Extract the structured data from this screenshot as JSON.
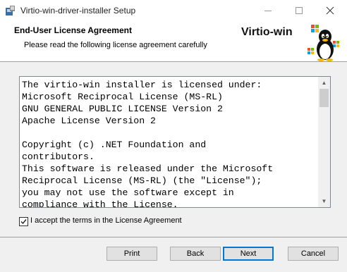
{
  "window": {
    "title": "Virtio-win-driver-installer Setup"
  },
  "banner": {
    "title": "End-User License Agreement",
    "subtitle": "Please read the following license agreement carefully",
    "brand": "Virtio-win"
  },
  "license": {
    "text": "The virtio-win installer is licensed under:\nMicrosoft Reciprocal License (MS-RL)\nGNU GENERAL PUBLIC LICENSE Version 2\nApache License Version 2\n\nCopyright (c) .NET Foundation and\ncontributors.\nThis software is released under the Microsoft\nReciprocal License (MS-RL) (the \"License\");\nyou may not use the software except in\ncompliance with the License."
  },
  "accept": {
    "label": "I accept the terms in the License Agreement",
    "checked": true
  },
  "buttons": {
    "print": "Print",
    "back": "Back",
    "next": "Next",
    "cancel": "Cancel"
  }
}
